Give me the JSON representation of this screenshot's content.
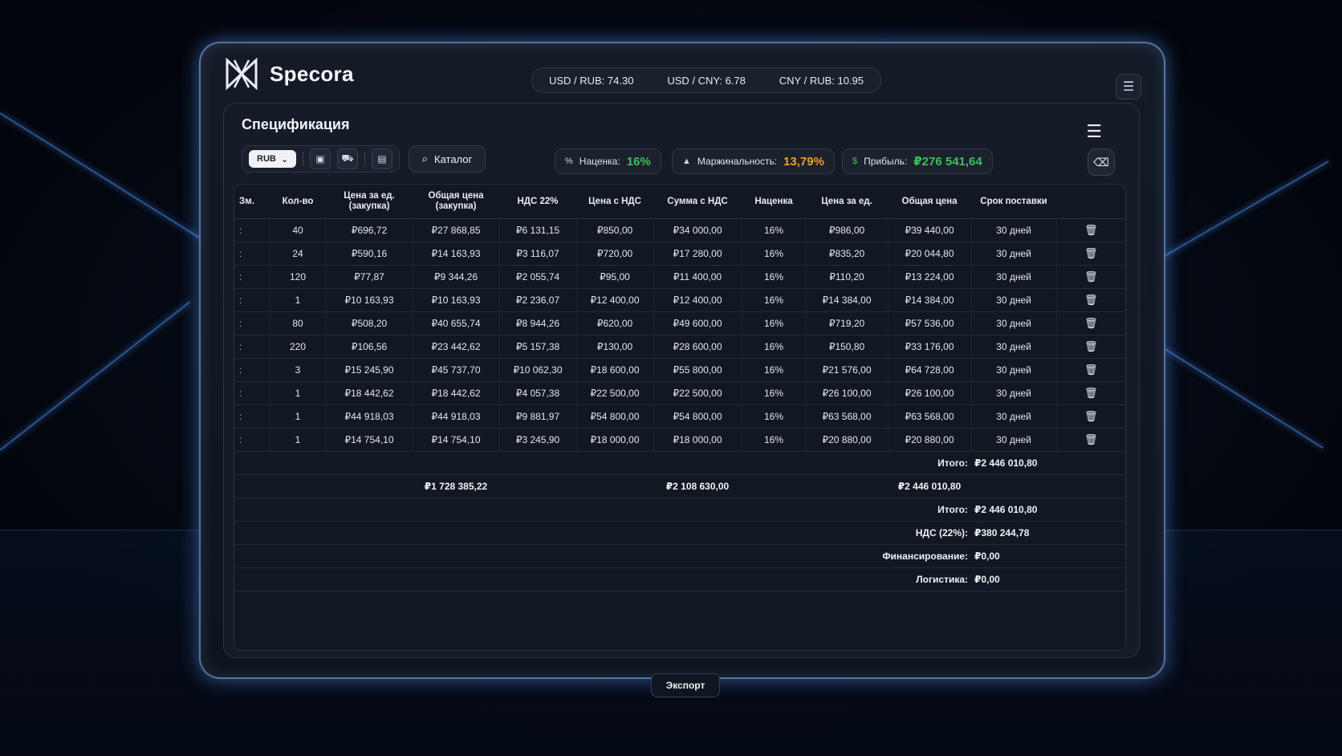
{
  "app": {
    "name": "Specora"
  },
  "rates": [
    {
      "label": "USD / RUB: 74.30"
    },
    {
      "label": "USD / CNY:  6.78"
    },
    {
      "label": "CNY / RUB: 10.95"
    }
  ],
  "panel": {
    "title": "Спецификация"
  },
  "toolbar": {
    "currency": "RUB",
    "catalog_label": "Каталог"
  },
  "metrics": {
    "markup": {
      "label": "Наценка:",
      "value": "16%",
      "color": "#3fbf5a"
    },
    "margin": {
      "label": "Маржинальность:",
      "value": "13,79%",
      "color": "#f0a020"
    },
    "profit": {
      "label": "Прибыль:",
      "value": "₽276 541,64",
      "color": "#3fbf5a"
    }
  },
  "table": {
    "headers": [
      "Зм.",
      "Кол-во",
      "Цена за ед. (закупка)",
      "Общая цена (закупка)",
      "НДС 22%",
      "Цена с НДС",
      "Сумма с НДС",
      "Наценка",
      "Цена за ед.",
      "Общая цена",
      "Срок поставки",
      ""
    ],
    "rows": [
      [
        ":",
        "40",
        "₽696,72",
        "₽27 868,85",
        "₽6 131,15",
        "₽850,00",
        "₽34 000,00",
        "16%",
        "₽986,00",
        "₽39 440,00",
        "30 дней"
      ],
      [
        ":",
        "24",
        "₽590,16",
        "₽14 163,93",
        "₽3 116,07",
        "₽720,00",
        "₽17 280,00",
        "16%",
        "₽835,20",
        "₽20 044,80",
        "30 дней"
      ],
      [
        ":",
        "120",
        "₽77,87",
        "₽9 344,26",
        "₽2 055,74",
        "₽95,00",
        "₽11 400,00",
        "16%",
        "₽110,20",
        "₽13 224,00",
        "30 дней"
      ],
      [
        ":",
        "1",
        "₽10 163,93",
        "₽10 163,93",
        "₽2 236,07",
        "₽12 400,00",
        "₽12 400,00",
        "16%",
        "₽14 384,00",
        "₽14 384,00",
        "30 дней"
      ],
      [
        ":",
        "80",
        "₽508,20",
        "₽40 655,74",
        "₽8 944,26",
        "₽620,00",
        "₽49 600,00",
        "16%",
        "₽719,20",
        "₽57 536,00",
        "30 дней"
      ],
      [
        ":",
        "220",
        "₽106,56",
        "₽23 442,62",
        "₽5 157,38",
        "₽130,00",
        "₽28 600,00",
        "16%",
        "₽150,80",
        "₽33 176,00",
        "30 дней"
      ],
      [
        ":",
        "3",
        "₽15 245,90",
        "₽45 737,70",
        "₽10 062,30",
        "₽18 600,00",
        "₽55 800,00",
        "16%",
        "₽21 576,00",
        "₽64 728,00",
        "30 дней"
      ],
      [
        ":",
        "1",
        "₽18 442,62",
        "₽18 442,62",
        "₽4 057,38",
        "₽22 500,00",
        "₽22 500,00",
        "16%",
        "₽26 100,00",
        "₽26 100,00",
        "30 дней"
      ],
      [
        ":",
        "1",
        "₽44 918,03",
        "₽44 918,03",
        "₽9 881,97",
        "₽54 800,00",
        "₽54 800,00",
        "16%",
        "₽63 568,00",
        "₽63 568,00",
        "30 дней"
      ],
      [
        ":",
        "1",
        "₽14 754,10",
        "₽14 754,10",
        "₽3 245,90",
        "₽18 000,00",
        "₽18 000,00",
        "16%",
        "₽20 880,00",
        "₽20 880,00",
        "30 дней"
      ]
    ]
  },
  "totals": {
    "subtotal_label": "Итого:",
    "subtotal_value": "₽2 446 010,80",
    "purchase_total": "₽1 728 385,22",
    "vat_sum_total": "₽2 108 630,00",
    "grand_total_col": "₽2 446 010,80",
    "summary": [
      {
        "label": "Итого:",
        "value": "₽2 446 010,80"
      },
      {
        "label": "НДС (22%):",
        "value": "₽380 244,78"
      },
      {
        "label": "Финансирование:",
        "value": "₽0,00"
      },
      {
        "label": "Логистика:",
        "value": "₽0,00"
      }
    ]
  },
  "export_label": "Экспорт"
}
